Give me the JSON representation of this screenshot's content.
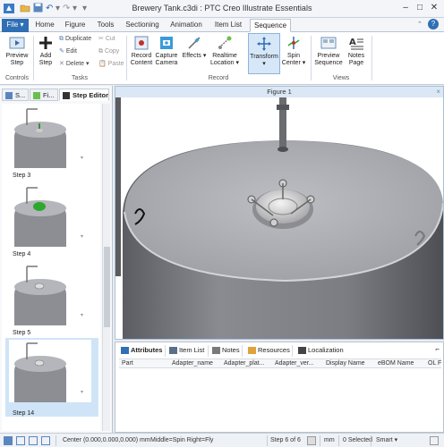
{
  "window": {
    "title": "Brewery Tank.c3di : PTC Creo Illustrate Essentials",
    "help_label": "?"
  },
  "tabs": [
    {
      "label": "File ▾"
    },
    {
      "label": "Home"
    },
    {
      "label": "Figure"
    },
    {
      "label": "Tools"
    },
    {
      "label": "Sectioning"
    },
    {
      "label": "Animation"
    },
    {
      "label": "Item List"
    },
    {
      "label": "Sequence"
    }
  ],
  "ribbon": {
    "preview_step": "Preview Step",
    "add_step": "Add Step",
    "duplicate": "Duplicate",
    "edit": "Edit",
    "delete": "Delete ▾",
    "cut": "Cut",
    "copy": "Copy",
    "paste": "Paste",
    "record_content": "Record Content",
    "capture_camera": "Capture Camera",
    "effects": "Effects ▾",
    "realtime_location": "Realtime Location ▾",
    "transform": "Transform ▾",
    "spin_center": "Spin Center ▾",
    "preview_sequence": "Preview Sequence",
    "notes_page": "Notes Page",
    "groups": {
      "controls": "Controls",
      "tasks": "Tasks",
      "record": "Record",
      "views": "Views"
    }
  },
  "left_panel": {
    "tabs": [
      {
        "label": "S..."
      },
      {
        "label": "Fi..."
      },
      {
        "label": "Step Editor"
      }
    ],
    "steps": [
      {
        "label": "Step 3"
      },
      {
        "label": "Step 4"
      },
      {
        "label": "Step 5"
      },
      {
        "label": "Step 14"
      }
    ]
  },
  "figure": {
    "title": "Figure 1",
    "close": "×"
  },
  "bottom_panel": {
    "tabs": [
      {
        "label": "Attributes"
      },
      {
        "label": "Item List"
      },
      {
        "label": "Notes"
      },
      {
        "label": "Resources"
      },
      {
        "label": "Localization"
      }
    ],
    "columns": [
      "Part",
      "Adapter_name",
      "Adapter_plat...",
      "Adapter_ver...",
      "Display Name",
      "eBOM Name",
      "OL F"
    ]
  },
  "status_bar": {
    "center": "Center (0.000,0.000,0.000) mm",
    "mouse": "Middle=Spin  Right=Fly",
    "step": "Step 6 of 6",
    "units": "mm",
    "selected": "0 Selected",
    "filter": "Smart ▾"
  },
  "colors": {
    "accent": "#2f6fb5",
    "selected_step": "#cfe4f7",
    "figure_header": "#dbe7f4",
    "highlight_part": "#2da82d"
  }
}
